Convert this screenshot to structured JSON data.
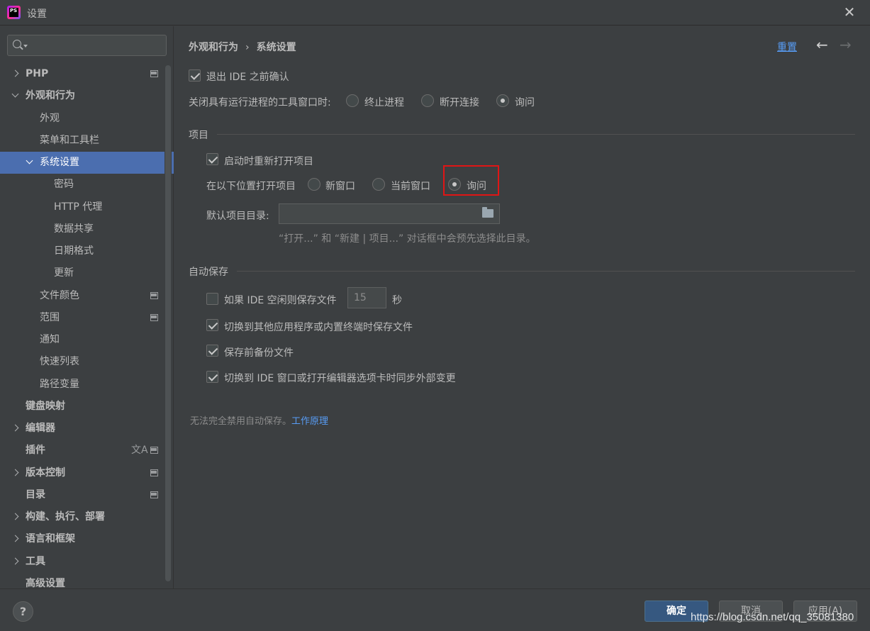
{
  "window": {
    "title": "设置",
    "close_icon": "close-icon"
  },
  "search": {
    "placeholder": "",
    "value": ""
  },
  "sidebar": {
    "items": [
      {
        "label": "PHP"
      },
      {
        "label": "外观和行为"
      },
      {
        "label": "外观"
      },
      {
        "label": "菜单和工具栏"
      },
      {
        "label": "系统设置"
      },
      {
        "label": "密码"
      },
      {
        "label": "HTTP 代理"
      },
      {
        "label": "数据共享"
      },
      {
        "label": "日期格式"
      },
      {
        "label": "更新"
      },
      {
        "label": "文件颜色"
      },
      {
        "label": "范围"
      },
      {
        "label": "通知"
      },
      {
        "label": "快速列表"
      },
      {
        "label": "路径变量"
      },
      {
        "label": "键盘映射"
      },
      {
        "label": "编辑器"
      },
      {
        "label": "插件"
      },
      {
        "label": "版本控制"
      },
      {
        "label": "目录"
      },
      {
        "label": "构建、执行、部署"
      },
      {
        "label": "语言和框架"
      },
      {
        "label": "工具"
      },
      {
        "label": "高级设置"
      }
    ]
  },
  "header": {
    "breadcrumb_parent": "外观和行为",
    "breadcrumb_sep": "›",
    "breadcrumb_current": "系统设置",
    "reset_label": "重置",
    "back_icon": "←",
    "forward_icon": "→"
  },
  "general": {
    "confirm_exit_label": "退出 IDE 之前确认",
    "confirm_exit_checked": true,
    "close_tool_label": "关闭具有运行进程的工具窗口时:",
    "close_tool_options": [
      "终止进程",
      "断开连接",
      "询问"
    ],
    "close_tool_selected": "询问"
  },
  "project": {
    "section_title": "项目",
    "reopen_label": "启动时重新打开项目",
    "reopen_checked": true,
    "open_in_label": "在以下位置打开项目",
    "open_in_options": [
      "新窗口",
      "当前窗口",
      "询问"
    ],
    "open_in_selected": "询问",
    "default_dir_label": "默认项目目录:",
    "default_dir_value": "",
    "hint": "“打开...” 和 “新建 | 项目...” 对话框中会预先选择此目录。"
  },
  "autosave": {
    "section_title": "自动保存",
    "idle_label": "如果 IDE 空闲则保存文件",
    "idle_checked": false,
    "idle_seconds": "15",
    "idle_unit": "秒",
    "switch_app_label": "切换到其他应用程序或内置终端时保存文件",
    "switch_app_checked": true,
    "backup_label": "保存前备份文件",
    "backup_checked": true,
    "sync_label": "切换到 IDE 窗口或打开编辑器选项卡时同步外部变更",
    "sync_checked": true
  },
  "footer_note": {
    "text": "无法完全禁用自动保存。",
    "link": "工作原理"
  },
  "buttons": {
    "help": "?",
    "ok": "确定",
    "cancel": "取消",
    "apply": "应用(A)"
  },
  "watermark": "https://blog.csdn.net/qq_35081380"
}
